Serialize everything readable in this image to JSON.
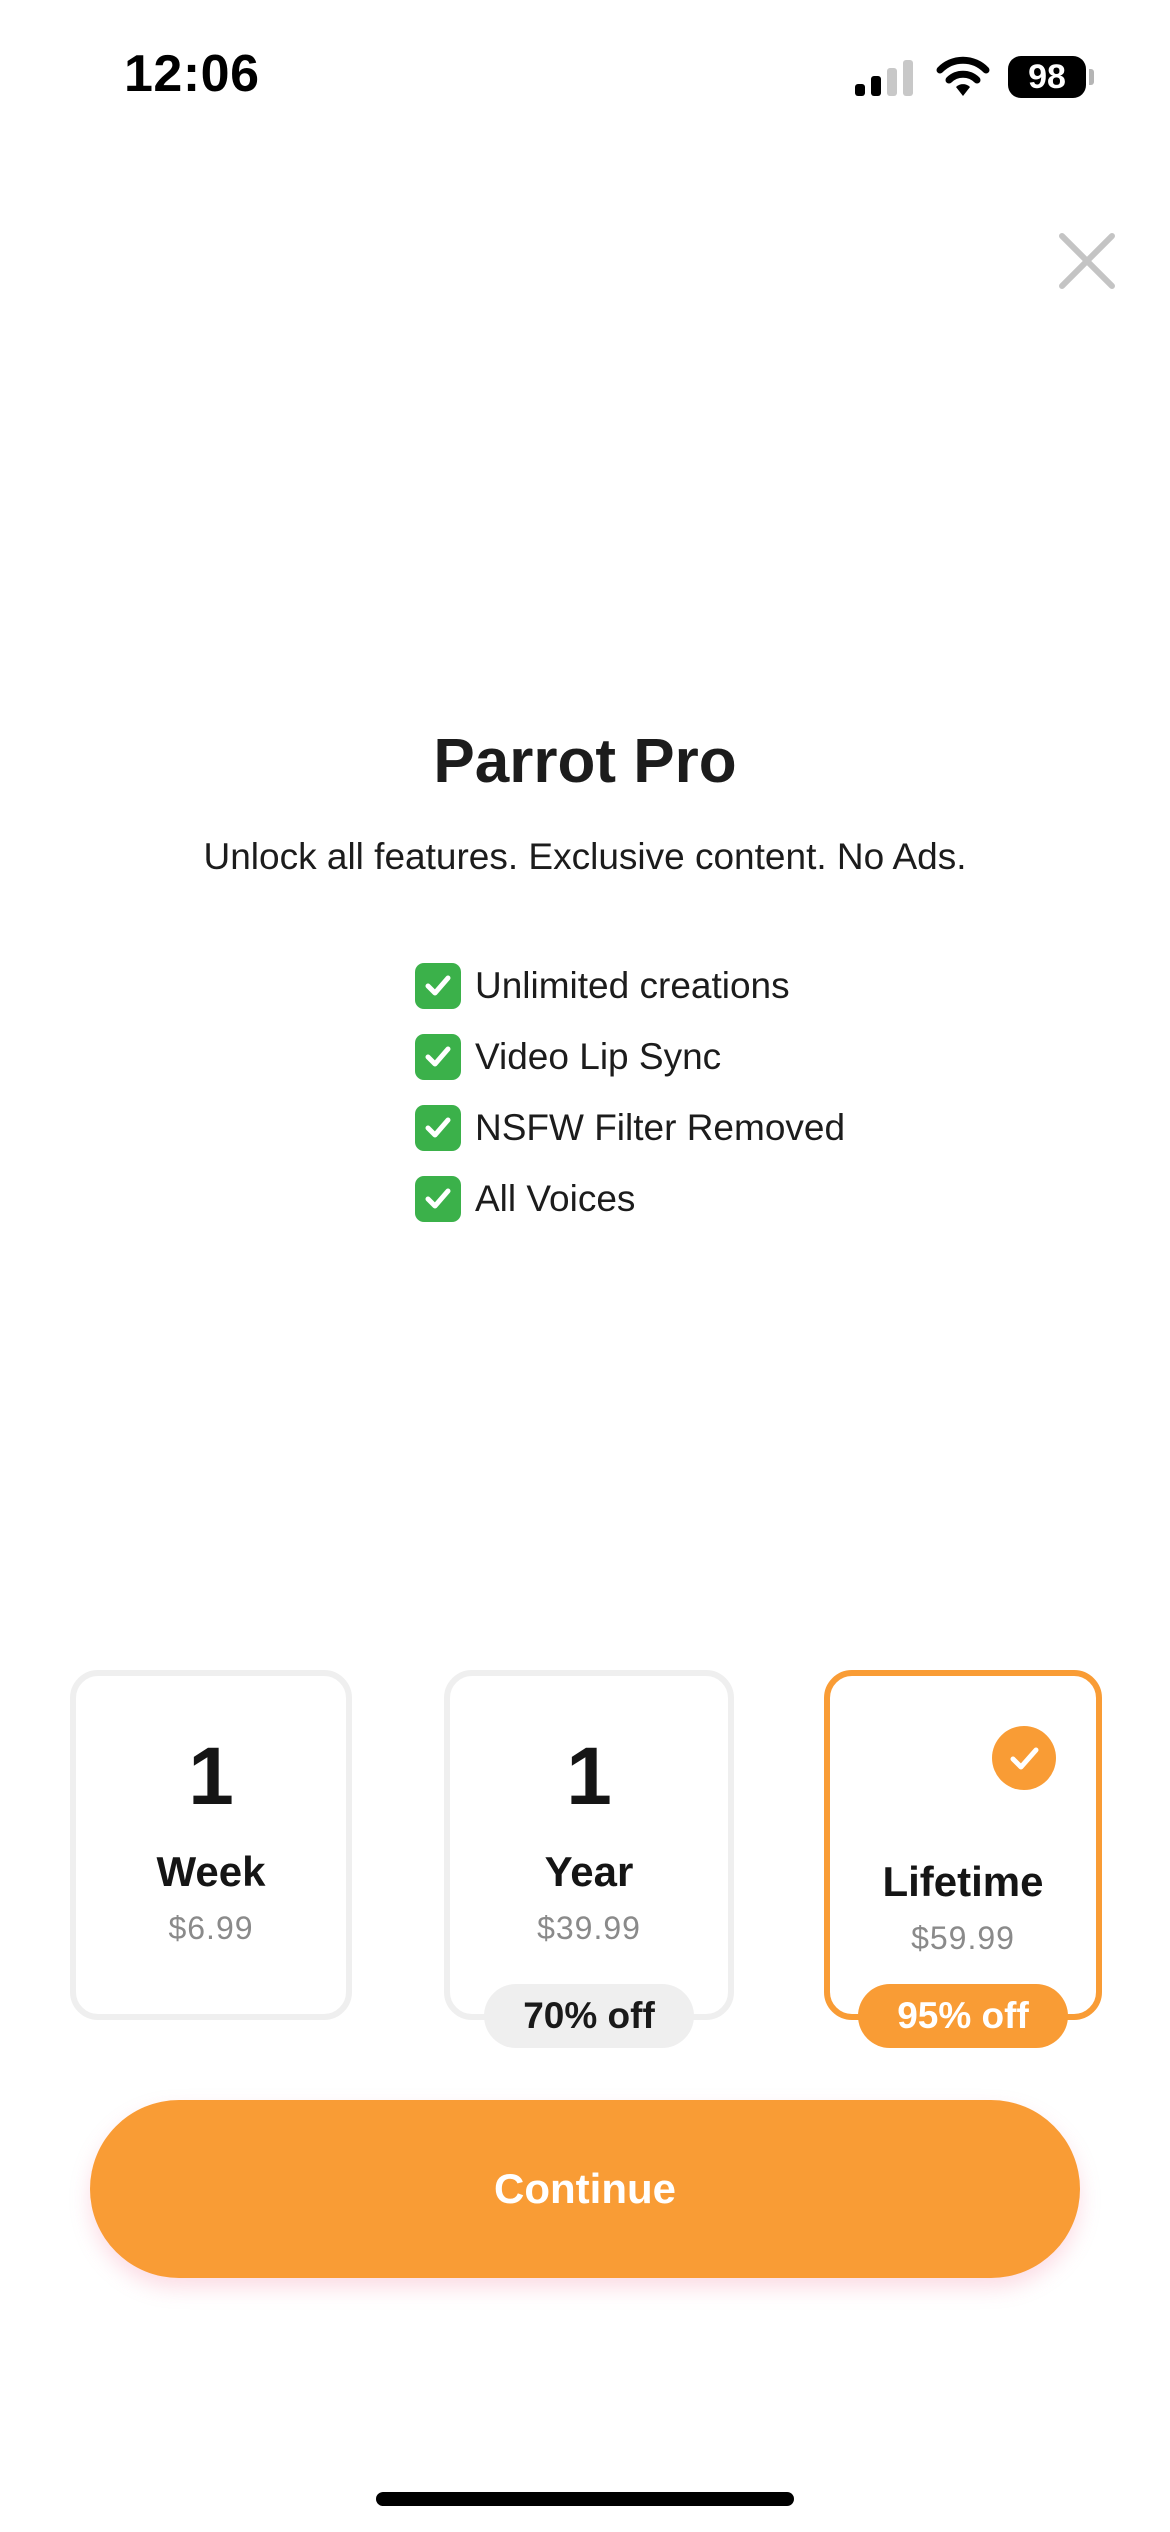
{
  "status_bar": {
    "time": "12:06",
    "battery": "98",
    "signal_icon": "cellular-signal-icon",
    "wifi_icon": "wifi-icon"
  },
  "close_icon": "close-icon",
  "header": {
    "title": "Parrot Pro",
    "subtitle": "Unlock all features. Exclusive content. No Ads."
  },
  "features": [
    {
      "label": "Unlimited creations",
      "icon": "check-box-icon"
    },
    {
      "label": "Video Lip Sync",
      "icon": "check-box-icon"
    },
    {
      "label": "NSFW Filter Removed",
      "icon": "check-box-icon"
    },
    {
      "label": "All Voices",
      "icon": "check-box-icon"
    }
  ],
  "plans": {
    "week": {
      "qty": "1",
      "unit": "Week",
      "price": "$6.99"
    },
    "year": {
      "qty": "1",
      "unit": "Year",
      "price": "$39.99",
      "badge": "70% off"
    },
    "lifetime": {
      "unit": "Lifetime",
      "price": "$59.99",
      "badge": "95% off",
      "selected": true
    }
  },
  "cta": {
    "label": "Continue"
  },
  "colors": {
    "accent": "#f99c35",
    "check_green": "#3bb14a",
    "card_border": "#efefef",
    "price_gray": "#8a8a8a"
  }
}
